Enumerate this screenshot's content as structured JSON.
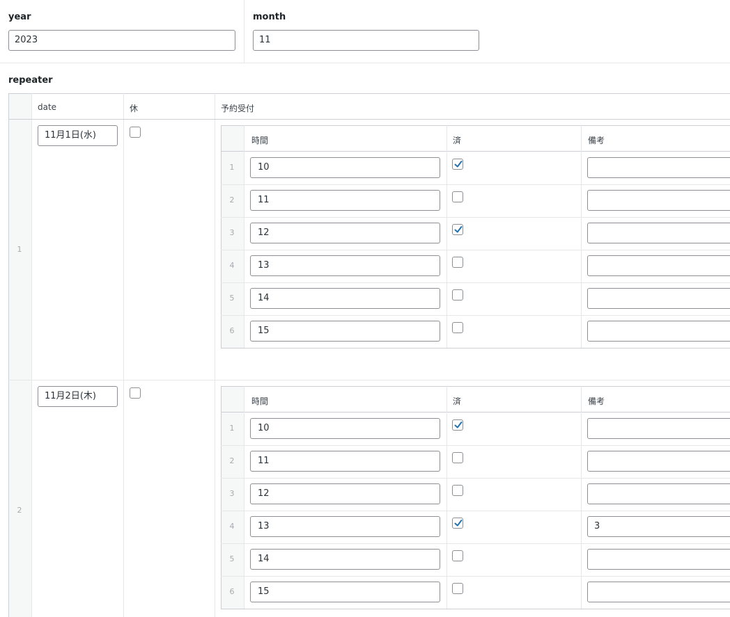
{
  "fields": {
    "year": {
      "label": "year",
      "value": "2023"
    },
    "month": {
      "label": "month",
      "value": "11"
    }
  },
  "repeater": {
    "label": "repeater",
    "columns": {
      "date": "date",
      "holiday": "休",
      "reservation": "予約受付"
    },
    "sub_columns": {
      "time": "時間",
      "done": "済",
      "note": "備考"
    },
    "rows": [
      {
        "index": "1",
        "date": "11月1日(水)",
        "holiday": false,
        "slots": [
          {
            "index": "1",
            "time": "10",
            "done": true,
            "note": ""
          },
          {
            "index": "2",
            "time": "11",
            "done": false,
            "note": ""
          },
          {
            "index": "3",
            "time": "12",
            "done": true,
            "note": ""
          },
          {
            "index": "4",
            "time": "13",
            "done": false,
            "note": ""
          },
          {
            "index": "5",
            "time": "14",
            "done": false,
            "note": ""
          },
          {
            "index": "6",
            "time": "15",
            "done": false,
            "note": ""
          }
        ]
      },
      {
        "index": "2",
        "date": "11月2日(木)",
        "holiday": false,
        "slots": [
          {
            "index": "1",
            "time": "10",
            "done": true,
            "note": ""
          },
          {
            "index": "2",
            "time": "11",
            "done": false,
            "note": ""
          },
          {
            "index": "3",
            "time": "12",
            "done": false,
            "note": ""
          },
          {
            "index": "4",
            "time": "13",
            "done": true,
            "note": "3"
          },
          {
            "index": "5",
            "time": "14",
            "done": false,
            "note": ""
          },
          {
            "index": "6",
            "time": "15",
            "done": false,
            "note": ""
          }
        ]
      }
    ]
  },
  "colors": {
    "checkmark": "#2271b1",
    "input_border": "#8c8f94",
    "table_border": "#ccd0d4",
    "gutter": "#f6f7f7"
  }
}
